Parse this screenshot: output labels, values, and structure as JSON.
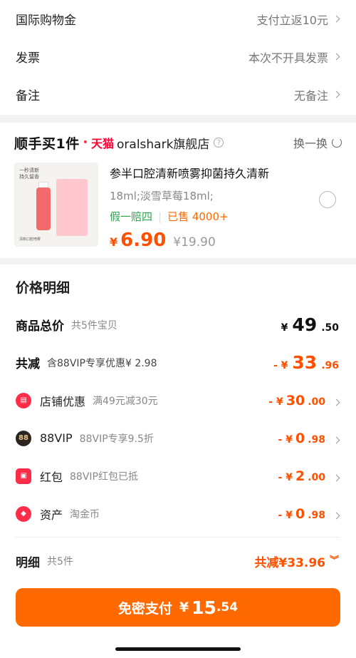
{
  "top": {
    "rows": [
      {
        "label": "国际购物金",
        "value": "支付立返10元"
      },
      {
        "label": "发票",
        "value": "本次不开具发票"
      },
      {
        "label": "备注",
        "value": "无备注"
      }
    ]
  },
  "shunshou": {
    "logo": "顺手买1件",
    "tmall": "天猫",
    "shop": "oralshark旗舰店",
    "swap": "换一换",
    "product": {
      "thumb_text1": "一秒清新",
      "thumb_text2": "持久留香",
      "thumb_strip": "清新口腔喷雾",
      "title": "参半口腔清新喷雾抑菌持久清新",
      "spec": "18ml;淡雪草莓18ml;",
      "tag": "假一赔四",
      "sold": "已售 4000+",
      "currency": "¥",
      "price": "6.90",
      "original": "¥19.90"
    }
  },
  "price_detail": {
    "title": "价格明细",
    "total": {
      "label": "商品总价",
      "sub": "共5件宝贝",
      "cur": "¥",
      "int": "49",
      "dec": ".50"
    },
    "reduce": {
      "label": "共减",
      "sub": "含88VIP专享优惠¥ 2.98",
      "prefix": "- ¥",
      "int": "33",
      "dec": ".96"
    },
    "discounts": [
      {
        "label": "店铺优惠",
        "sub": "满49元减30元",
        "prefix": "- ¥",
        "int": "30",
        "dec": ".00",
        "icon": "store-icon",
        "color": "#ff2d4a"
      },
      {
        "label": "88VIP",
        "sub": "88VIP专享9.5折",
        "prefix": "- ¥",
        "int": "0",
        "dec": ".98",
        "icon": "vip-icon",
        "color": "#2b2420"
      },
      {
        "label": "红包",
        "sub": "88VIP红包已抵",
        "prefix": "- ¥",
        "int": "2",
        "dec": ".00",
        "icon": "redpacket-icon",
        "color": "#ff2d4a"
      },
      {
        "label": "资产",
        "sub": "淘金币",
        "prefix": "- ¥",
        "int": "0",
        "dec": ".98",
        "icon": "coin-icon",
        "color": "#ff2d4a"
      }
    ],
    "summary": {
      "label": "明细",
      "sub": "共5件",
      "right": "共减¥33.96"
    }
  },
  "pay": {
    "label": "免密支付",
    "cur": "¥",
    "int": "15",
    "dec": ".54"
  },
  "colors": {
    "accent": "#ff5000",
    "button": "#ff6a00",
    "green": "#2ea44f"
  }
}
